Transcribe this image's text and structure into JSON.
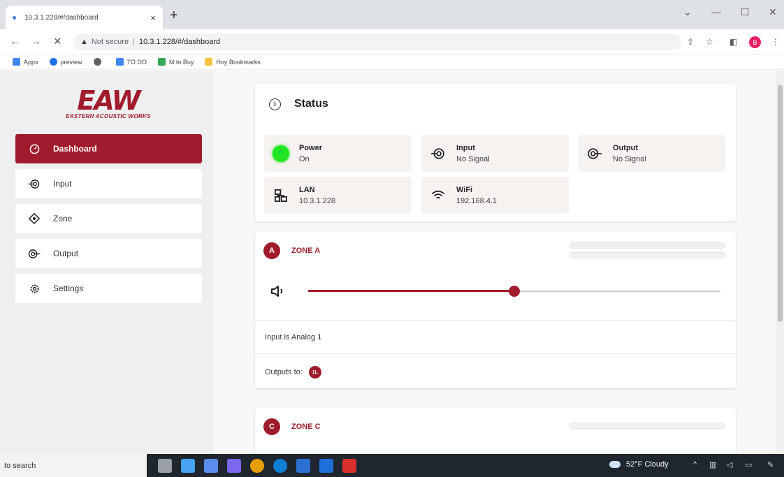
{
  "browser": {
    "tab_title": "10.3.1.228/#/dashboard",
    "close_glyph": "×",
    "newtab_glyph": "+",
    "window_controls": {
      "collapse": "⌄",
      "minimize": "—",
      "maximize": "☐",
      "close": "✕"
    },
    "back": "←",
    "forward": "→",
    "stop": "✕",
    "security": "Not secure",
    "url": "10.3.1.228/#/dashboard",
    "profile_initial": "B",
    "bookmarks": [
      {
        "label": "Apps",
        "color": "#4285f4"
      },
      {
        "label": "preview",
        "color": "#1a73e8"
      },
      {
        "label": "",
        "color": "#5f6368"
      },
      {
        "label": "TO DO",
        "color": "#4285f4"
      },
      {
        "label": "M to Buy",
        "color": "#34a853"
      },
      {
        "label": "Hoy Bookmarks",
        "color": "#f6c342"
      }
    ]
  },
  "brand": {
    "logo_text": "EAW",
    "logo_sub": "EASTERN ACOUSTIC WORKS",
    "accent": "#a01c2c"
  },
  "sidebar": {
    "items": [
      {
        "label": "Dashboard",
        "icon": "dashboard-icon",
        "active": true
      },
      {
        "label": "Input",
        "icon": "input-icon",
        "active": false
      },
      {
        "label": "Zone",
        "icon": "zone-icon",
        "active": false
      },
      {
        "label": "Output",
        "icon": "output-icon",
        "active": false
      },
      {
        "label": "Settings",
        "icon": "gear-icon",
        "active": false
      }
    ]
  },
  "status": {
    "title": "Status",
    "info_glyph": "i",
    "power": {
      "label": "Power",
      "value": "On",
      "color": "#22e622"
    },
    "input": {
      "label": "Input",
      "value": "No Signal"
    },
    "output": {
      "label": "Output",
      "value": "No Signal"
    },
    "lan": {
      "label": "LAN",
      "value": "10.3.1.228"
    },
    "wifi": {
      "label": "WiFi",
      "value": "192.168.4.1"
    }
  },
  "zones": [
    {
      "badge": "A",
      "name": "ZONE A",
      "volume_fraction": 0.5,
      "input_text": "Input is Analog 1",
      "outputs_label": "Outputs to:",
      "outputs": [
        "1L"
      ]
    },
    {
      "badge": "C",
      "name": "ZONE C"
    }
  ],
  "taskbar": {
    "search_text": "to search",
    "weather": "52°F Cloudy",
    "tray_caret": "^",
    "apps": [
      "#9aa0a6",
      "#4aa3f0",
      "#5b8def",
      "#7b68ee",
      "#e8a000",
      "#0f7fd6",
      "#2b6fd1",
      "#1e6fd9",
      "#d8312b"
    ]
  }
}
